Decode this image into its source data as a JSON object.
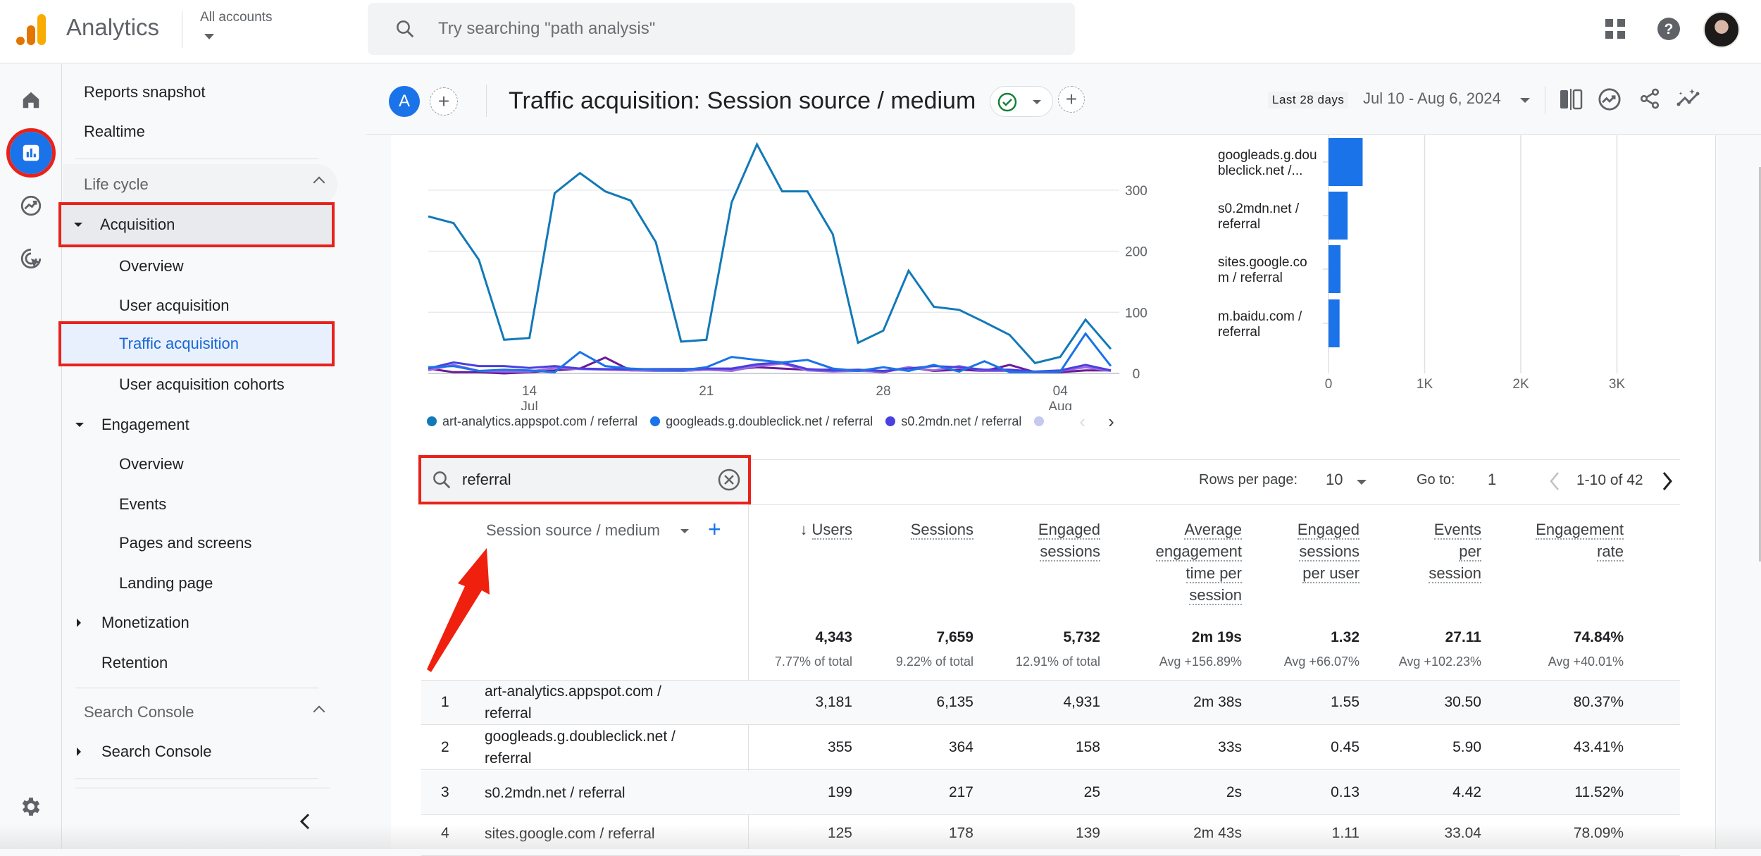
{
  "topbar": {
    "app_title": "Analytics",
    "account_label": "All accounts",
    "search_placeholder": "Try searching \"path analysis\""
  },
  "rail": {
    "items": [
      "home-icon",
      "reports-icon",
      "explore-icon",
      "advertising-icon"
    ],
    "active": "reports-icon"
  },
  "nav": {
    "reports_snapshot": "Reports snapshot",
    "realtime": "Realtime",
    "lifecycle_section": "Life cycle",
    "acquisition": "Acquisition",
    "acq_overview": "Overview",
    "user_acquisition": "User acquisition",
    "traffic_acquisition": "Traffic acquisition",
    "user_acq_cohorts": "User acquisition cohorts",
    "engagement": "Engagement",
    "eng_overview": "Overview",
    "events": "Events",
    "pages_screens": "Pages and screens",
    "landing_page": "Landing page",
    "monetization": "Monetization",
    "retention": "Retention",
    "search_console_section": "Search Console",
    "search_console": "Search Console"
  },
  "report": {
    "segment_letter": "A",
    "title": "Traffic acquisition: Session source / medium",
    "date_preset": "Last 28 days",
    "date_range": "Jul 10 - Aug 6, 2024"
  },
  "chart_data": [
    {
      "type": "line",
      "title": "",
      "x": [
        "Jul 10",
        "Jul 11",
        "Jul 12",
        "Jul 13",
        "Jul 14",
        "Jul 15",
        "Jul 16",
        "Jul 17",
        "Jul 18",
        "Jul 19",
        "Jul 20",
        "Jul 21",
        "Jul 22",
        "Jul 23",
        "Jul 24",
        "Jul 25",
        "Jul 26",
        "Jul 27",
        "Jul 28",
        "Jul 29",
        "Jul 30",
        "Jul 31",
        "Aug 1",
        "Aug 2",
        "Aug 3",
        "Aug 4",
        "Aug 5",
        "Aug 6"
      ],
      "x_tick_labels": [
        {
          "at": "Jul 14",
          "label": "14",
          "sub": "Jul"
        },
        {
          "at": "Jul 21",
          "label": "21",
          "sub": ""
        },
        {
          "at": "Jul 28",
          "label": "28",
          "sub": ""
        },
        {
          "at": "Aug 4",
          "label": "04",
          "sub": "Aug"
        }
      ],
      "y_ticks": [
        0,
        100,
        200,
        300
      ],
      "ylim": [
        0,
        370
      ],
      "y_axis_side": "right",
      "grid": true,
      "series": [
        {
          "name": "art-analytics.appspot.com / referral",
          "color": "#1279b8",
          "values": [
            257,
            246,
            186,
            55,
            58,
            295,
            328,
            298,
            283,
            215,
            52,
            55,
            280,
            375,
            298,
            298,
            228,
            50,
            70,
            168,
            109,
            104,
            84,
            63,
            17,
            27,
            88,
            40
          ]
        },
        {
          "name": "googleads.g.doubleclick.net / referral",
          "color": "#1a73e8",
          "values": [
            10,
            12,
            4,
            6,
            5,
            2,
            35,
            12,
            8,
            6,
            5,
            10,
            27,
            22,
            18,
            22,
            8,
            4,
            10,
            4,
            14,
            3,
            20,
            2,
            2,
            3,
            65,
            12
          ]
        },
        {
          "name": "s0.2mdn.net / referral",
          "color": "#4a3fe0",
          "values": [
            8,
            18,
            12,
            12,
            9,
            12,
            8,
            7,
            7,
            7,
            7,
            8,
            8,
            15,
            18,
            7,
            5,
            6,
            4,
            8,
            12,
            10,
            6,
            6,
            3,
            5,
            14,
            5
          ]
        },
        {
          "name": "sites.google.com / referral",
          "color": "#9c6ade",
          "values": [
            5,
            14,
            4,
            3,
            3,
            9,
            7,
            6,
            5,
            4,
            4,
            6,
            4,
            12,
            16,
            5,
            3,
            4,
            3,
            10,
            5,
            12,
            4,
            4,
            2,
            4,
            10,
            4
          ]
        },
        {
          "name": "m.baidu.com / referral",
          "color": "#6a1b9a",
          "values": [
            8,
            2,
            2,
            0,
            2,
            5,
            8,
            26,
            5,
            6,
            4,
            6,
            6,
            10,
            8,
            6,
            6,
            5,
            2,
            10,
            4,
            6,
            4,
            14,
            2,
            2,
            5,
            5
          ]
        }
      ],
      "legend": {
        "visible_entries": [
          "art-analytics.appspot.com / referral",
          "googleads.g.doubleclick.net / referral",
          "s0.2mdn.net / referral"
        ],
        "placement": "bottom",
        "next_label": "›",
        "prev_label": "‹"
      }
    },
    {
      "type": "bar",
      "orientation": "horizontal",
      "categories": [
        "googleads.g.dou bleclick.net /...",
        "s0.2mdn.net / referral",
        "sites.google.co m / referral",
        "m.baidu.com / referral"
      ],
      "values": [
        355,
        199,
        125,
        115
      ],
      "x_ticks": [
        "0",
        "1K",
        "2K",
        "3K"
      ],
      "xlim": [
        0,
        3300
      ],
      "color": "#1a73e8",
      "grid": true
    }
  ],
  "table": {
    "search_value": "referral",
    "rows_per_page_label": "Rows per page:",
    "rows_per_page": "10",
    "goto_label": "Go to:",
    "goto_value": "1",
    "page_info": "1-10 of 42",
    "dimension_header": "Session source / medium",
    "sort_indicator": "↓",
    "columns": [
      {
        "label": [
          "Users"
        ],
        "total": "4,343",
        "total_sub": "7.77% of total",
        "sorted": true
      },
      {
        "label": [
          "Sessions"
        ],
        "total": "7,659",
        "total_sub": "9.22% of total"
      },
      {
        "label": [
          "Engaged",
          "sessions"
        ],
        "total": "5,732",
        "total_sub": "12.91% of total"
      },
      {
        "label": [
          "Average",
          "engagement",
          "time per",
          "session"
        ],
        "total": "2m 19s",
        "total_sub": "Avg +156.89%"
      },
      {
        "label": [
          "Engaged",
          "sessions",
          "per user"
        ],
        "total": "1.32",
        "total_sub": "Avg +66.07%"
      },
      {
        "label": [
          "Events",
          "per",
          "session"
        ],
        "total": "27.11",
        "total_sub": "Avg +102.23%"
      },
      {
        "label": [
          "Engagement",
          "rate"
        ],
        "total": "74.84%",
        "total_sub": "Avg +40.01%"
      }
    ],
    "rows": [
      {
        "num": "1",
        "dim": "art-analytics.appspot.com / referral",
        "values": [
          "3,181",
          "6,135",
          "4,931",
          "2m 38s",
          "1.55",
          "30.50",
          "80.37%"
        ]
      },
      {
        "num": "2",
        "dim": "googleads.g.doubleclick.net / referral",
        "values": [
          "355",
          "364",
          "158",
          "33s",
          "0.45",
          "5.90",
          "43.41%"
        ]
      },
      {
        "num": "3",
        "dim": "s0.2mdn.net / referral",
        "values": [
          "199",
          "217",
          "25",
          "2s",
          "0.13",
          "4.42",
          "11.52%"
        ]
      },
      {
        "num": "4",
        "dim": "sites.google.com / referral",
        "values": [
          "125",
          "178",
          "139",
          "2m 43s",
          "1.11",
          "33.04",
          "78.09%"
        ]
      }
    ]
  },
  "colors": {
    "accent": "#1a73e8",
    "annotation_red": "#e8221b",
    "selected_nav_bg": "#e8f0fe",
    "selected_nav_text": "#1967d2"
  }
}
